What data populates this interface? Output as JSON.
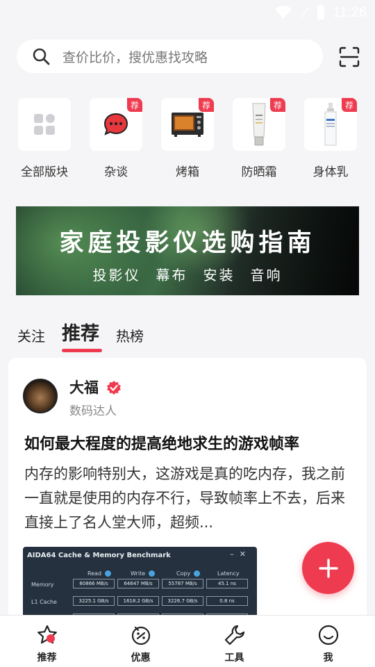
{
  "status_bar": {
    "time": "11:26"
  },
  "search": {
    "placeholder": "查价比价，搜优惠找攻略"
  },
  "categories": [
    {
      "label": "全部版块",
      "icon": "grid-icon",
      "badge": ""
    },
    {
      "label": "杂谈",
      "icon": "chat-bubble-icon",
      "badge": "荐"
    },
    {
      "label": "烤箱",
      "icon": "oven-icon",
      "badge": "荐"
    },
    {
      "label": "防晒霜",
      "icon": "sunscreen-tube-icon",
      "badge": "荐"
    },
    {
      "label": "身体乳",
      "icon": "lotion-bottle-icon",
      "badge": "荐"
    }
  ],
  "banner": {
    "title": "家庭投影仪选购指南",
    "tags": [
      "投影仪",
      "幕布",
      "安装",
      "音响"
    ]
  },
  "feed_tabs": [
    {
      "label": "关注",
      "active": false
    },
    {
      "label": "推荐",
      "active": true
    },
    {
      "label": "热榜",
      "active": false
    }
  ],
  "post": {
    "author": "大福",
    "author_role": "数码达人",
    "title": "如何最大程度的提高绝地求生的游戏帧率",
    "excerpt": "内存的影响特别大，这游戏是真的吃内存，我之前一直就是使用的内存不行，导致帧率上不去，后来直接上了名人堂大师，超频...",
    "image": {
      "window_title": "AIDA64 Cache & Memory Benchmark",
      "window_controls": "–✕",
      "columns": [
        "Read",
        "Write",
        "Copy",
        "Latency"
      ],
      "rows": [
        {
          "label": "Memory",
          "values": [
            "60866 MB/s",
            "64647 MB/s",
            "55787 MB/s",
            "45.1 ns"
          ]
        },
        {
          "label": "L1 Cache",
          "values": [
            "3225.1 GB/s",
            "1618.2 GB/s",
            "3226.7 GB/s",
            "0.8 ns"
          ]
        }
      ]
    }
  },
  "bottom_nav": [
    {
      "label": "推荐",
      "icon": "star-icon",
      "active": true
    },
    {
      "label": "优惠",
      "icon": "coupon-icon",
      "active": false
    },
    {
      "label": "工具",
      "icon": "wrench-icon",
      "active": false
    },
    {
      "label": "我",
      "icon": "smiley-icon",
      "active": false
    }
  ],
  "colors": {
    "accent": "#ee3b4f",
    "background": "#f5f5f7"
  }
}
